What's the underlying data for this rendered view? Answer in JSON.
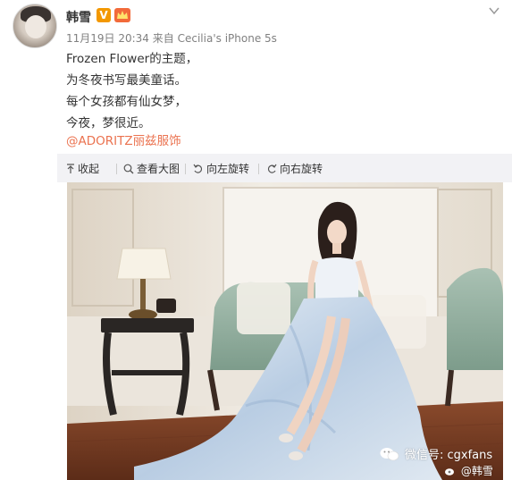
{
  "user": {
    "name": "韩雪",
    "verified_badge": "V",
    "colors": {
      "verified": "#f39800",
      "mention": "#eb7350"
    }
  },
  "meta": {
    "time": "11月19日 20:34",
    "source_prefix": "来自",
    "source": "Cecilia's iPhone 5s"
  },
  "post": {
    "lines": [
      "Frozen Flower的主题，",
      "为冬夜书写最美童话。",
      "每个女孩都有仙女梦，",
      "今夜，梦很近。"
    ],
    "mention": "@ADORITZ丽兹服饰"
  },
  "toolbar": {
    "collapse": "收起",
    "view_large": "查看大图",
    "rotate_left": "向左旋转",
    "rotate_right": "向右旋转"
  },
  "watermark": {
    "wechat": "微信号: cgxfans",
    "weibo": "@韩雪"
  },
  "icons": [
    "avatar",
    "verified-icon",
    "crown-icon",
    "chevron-down-icon",
    "collapse-arrow-icon",
    "search-icon",
    "rotate-left-icon",
    "rotate-right-icon",
    "wechat-icon",
    "weibo-icon"
  ]
}
